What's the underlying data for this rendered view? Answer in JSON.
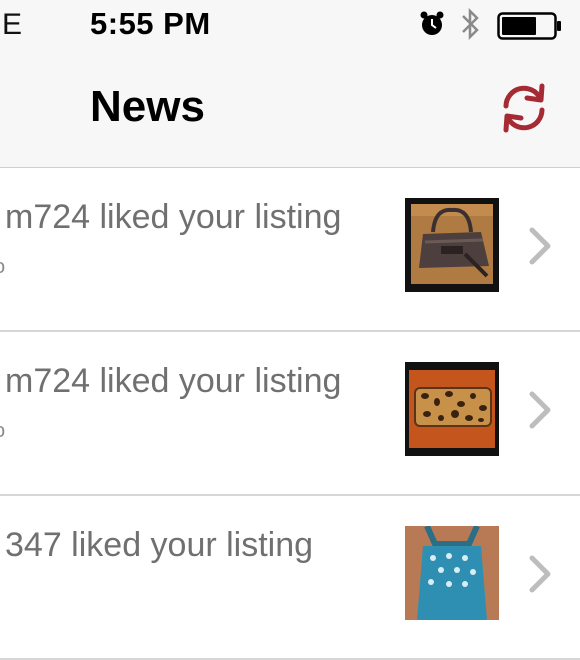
{
  "status_bar": {
    "carrier": "E",
    "time": "5:55 PM",
    "icons": [
      "alarm-icon",
      "bluetooth-icon",
      "battery-icon"
    ]
  },
  "nav": {
    "title": "News",
    "refresh_icon": "refresh-icon",
    "accent": "#a52a34"
  },
  "news_items": [
    {
      "text": "m724 liked your listing",
      "sub": "o",
      "thumbnail": "brown handbag photo"
    },
    {
      "text": "m724 liked your listing",
      "sub": "o",
      "thumbnail": "leopard print wallet photo"
    },
    {
      "text": "347 liked your listing",
      "sub": "",
      "thumbnail": "blue polka dot top photo"
    }
  ]
}
